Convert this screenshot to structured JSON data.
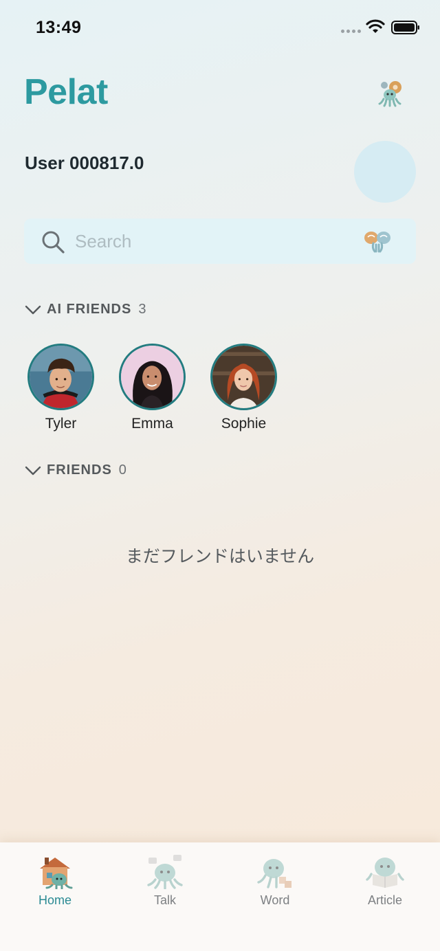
{
  "status_bar": {
    "time": "13:49"
  },
  "header": {
    "app_title": "Pelat",
    "user_name": "User 000817.0"
  },
  "search": {
    "placeholder": "Search",
    "value": ""
  },
  "ai_friends": {
    "title": "AI FRIENDS",
    "count": "3",
    "items": [
      {
        "name": "Tyler"
      },
      {
        "name": "Emma"
      },
      {
        "name": "Sophie"
      }
    ]
  },
  "friends": {
    "title": "FRIENDS",
    "count": "0",
    "empty_message": "まだフレンドはいません"
  },
  "tabs": [
    {
      "label": "Home",
      "icon": "home-icon",
      "active": true
    },
    {
      "label": "Talk",
      "icon": "talk-icon",
      "active": false
    },
    {
      "label": "Word",
      "icon": "word-icon",
      "active": false
    },
    {
      "label": "Article",
      "icon": "article-icon",
      "active": false
    }
  ],
  "colors": {
    "brand": "#2d9aa0",
    "active_tab": "#2a8a93",
    "avatar_ring": "#237c80"
  }
}
